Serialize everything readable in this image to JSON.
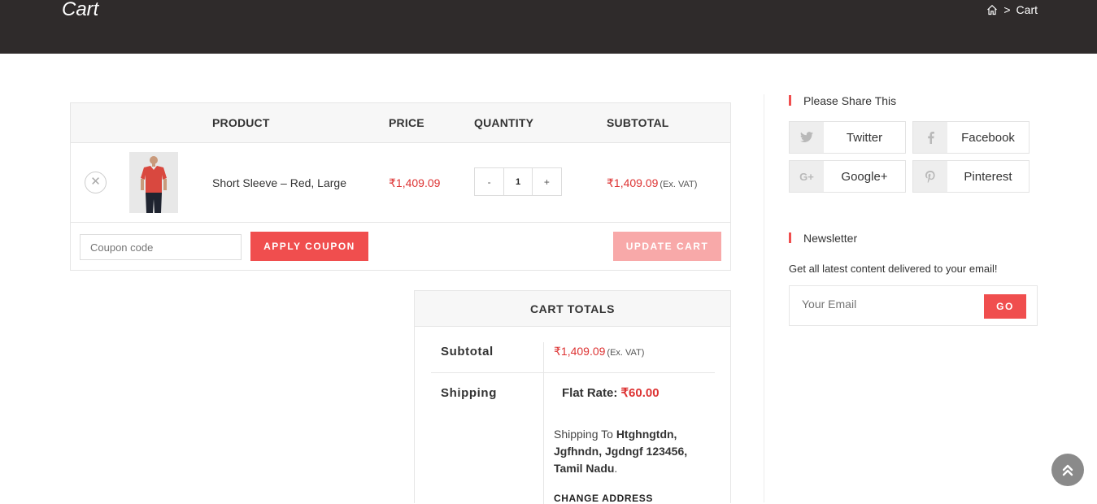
{
  "header": {
    "title": "Cart",
    "breadcrumb": {
      "home_icon": "home-icon",
      "separator": ">",
      "current": "Cart"
    }
  },
  "cart": {
    "columns": [
      "PRODUCT",
      "PRICE",
      "QUANTITY",
      "SUBTOTAL"
    ],
    "items": [
      {
        "remove_icon": "close-icon",
        "name": "Short Sleeve – Red, Large",
        "price": "₹1,409.09",
        "qty_minus": "-",
        "quantity": "1",
        "qty_plus": "+",
        "subtotal": "₹1,409.09",
        "subtotal_note": "(Ex. VAT)"
      }
    ],
    "coupon_placeholder": "Coupon code",
    "apply_label": "APPLY COUPON",
    "update_label": "UPDATE CART"
  },
  "totals": {
    "heading": "CART TOTALS",
    "subtotal_label": "Subtotal",
    "subtotal_value": "₹1,409.09",
    "subtotal_note": "(Ex. VAT)",
    "shipping_label": "Shipping",
    "flat_rate_label": "Flat Rate:",
    "flat_rate_value": "₹60.00",
    "shipping_to_prefix": "Shipping To",
    "shipping_address": "Htghngtdn, Jgfhndn, Jgdngf 123456, Tamil Nadu",
    "shipping_to_suffix": ".",
    "change_address": "CHANGE ADDRESS"
  },
  "sidebar": {
    "share_title": "Please Share This",
    "share_buttons": [
      {
        "label": "Twitter",
        "icon": "twitter-icon"
      },
      {
        "label": "Facebook",
        "icon": "facebook-icon"
      },
      {
        "label": "Google+",
        "icon": "google-plus-icon"
      },
      {
        "label": "Pinterest",
        "icon": "pinterest-icon"
      }
    ],
    "newsletter_title": "Newsletter",
    "newsletter_text": "Get all latest content delivered to your email!",
    "email_placeholder": "Your Email",
    "go_label": "GO"
  },
  "scroll_top_icon": "double-chevron-up-icon",
  "colors": {
    "accent": "#f04e4e",
    "header_bg": "#2f2b2b",
    "price": "#dd3333"
  }
}
